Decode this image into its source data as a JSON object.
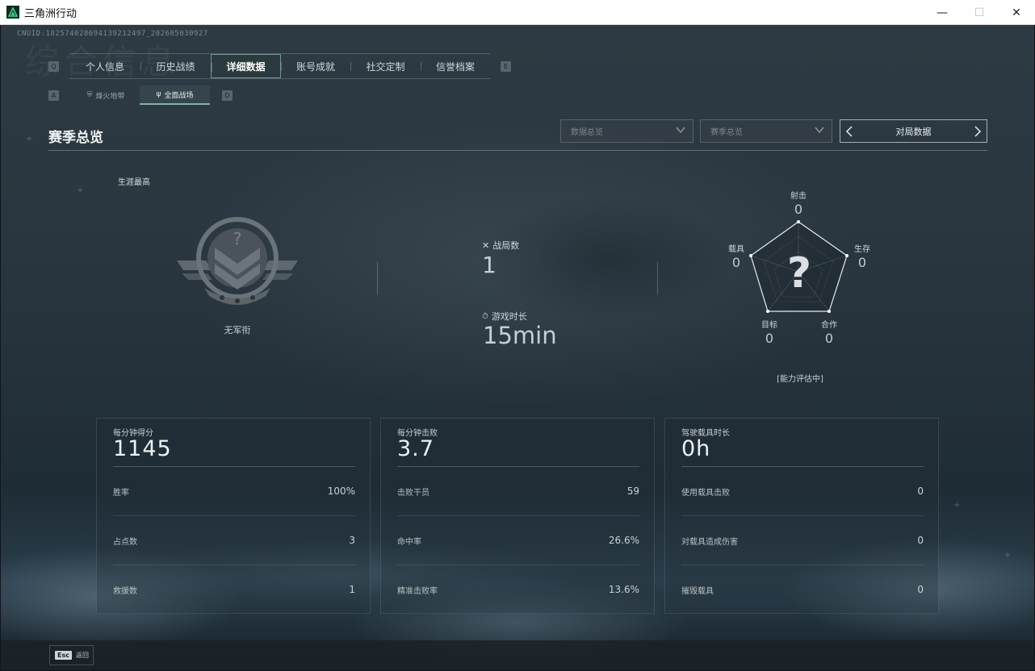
{
  "window": {
    "title": "三角洲行动",
    "min": "—",
    "max": "☐",
    "close": "✕"
  },
  "uid": "CNUID:1825740286941392124​97_202605030927",
  "ghost_title": "综合信息",
  "key_hints": {
    "left": "Q",
    "right": "E",
    "sub_left": "A",
    "sub_right": "D"
  },
  "main_tabs": [
    {
      "label": "个人信息"
    },
    {
      "label": "历史战绩"
    },
    {
      "label": "详细数据"
    },
    {
      "label": "账号成就"
    },
    {
      "label": "社交定制"
    },
    {
      "label": "信誉档案"
    }
  ],
  "sub_tabs": [
    {
      "label": "烽火地带"
    },
    {
      "label": "全面战场"
    }
  ],
  "section_title": "赛季总览",
  "dropdowns": {
    "data_overview": "数据总览",
    "season_overview": "赛季总览"
  },
  "pager": {
    "label": "对局数据"
  },
  "career": {
    "label": "生涯最高",
    "rank_label": "无军衔"
  },
  "matches": {
    "label": "战局数",
    "value": "1"
  },
  "playtime": {
    "label": "游戏时长",
    "value": "15min"
  },
  "radar": {
    "shooting": {
      "label": "射击",
      "value": "0"
    },
    "survival": {
      "label": "生存",
      "value": "0"
    },
    "cooperation": {
      "label": "合作",
      "value": "0"
    },
    "objective": {
      "label": "目标",
      "value": "0"
    },
    "vehicle": {
      "label": "载具",
      "value": "0"
    },
    "status": "[能力评估中]"
  },
  "cards": [
    {
      "head_label": "每分钟得分",
      "head_value": "1145",
      "rows": [
        {
          "k": "胜率",
          "v": "100%"
        },
        {
          "k": "占点数",
          "v": "3"
        },
        {
          "k": "救援数",
          "v": "1"
        }
      ]
    },
    {
      "head_label": "每分钟击败",
      "head_value": "3.7",
      "rows": [
        {
          "k": "击败干员",
          "v": "59"
        },
        {
          "k": "命中率",
          "v": "26.6%"
        },
        {
          "k": "精准击败率",
          "v": "13.6%"
        }
      ]
    },
    {
      "head_label": "驾驶载具时长",
      "head_value": "0h",
      "rows": [
        {
          "k": "使用载具击败",
          "v": "0"
        },
        {
          "k": "对载具造成伤害",
          "v": "0"
        },
        {
          "k": "摧毁载具",
          "v": "0"
        }
      ]
    }
  ],
  "bottom": {
    "esc_key": "Esc",
    "esc_label": "返回"
  },
  "colors": {
    "accent": "#7fb3a2",
    "panel_border": "#6f9a8c"
  }
}
